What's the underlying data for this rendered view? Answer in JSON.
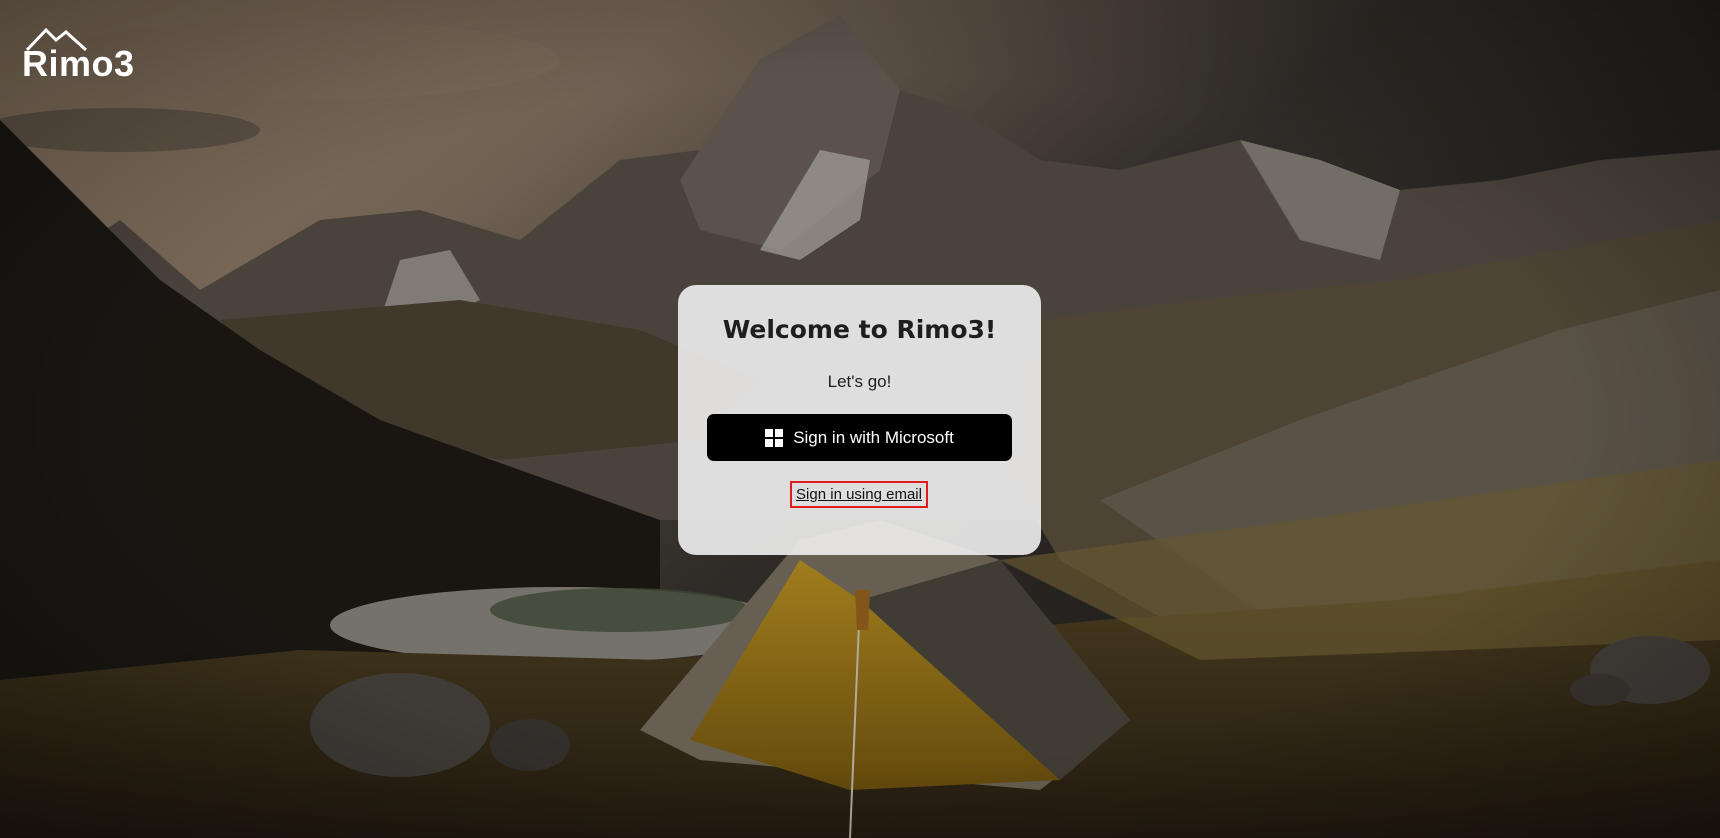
{
  "brand": {
    "logo_text": "Rimo3",
    "logo_icon": "mountain-peaks-icon"
  },
  "card": {
    "title": "Welcome to Rimo3!",
    "subtitle": "Let's go!",
    "microsoft_button_label": "Sign in with Microsoft",
    "microsoft_icon": "windows-logo-icon",
    "email_link_label": "Sign in using email"
  },
  "colors": {
    "button_bg": "#000000",
    "card_bg": "#f0f0f0",
    "focus_outline": "#e01b1b"
  }
}
